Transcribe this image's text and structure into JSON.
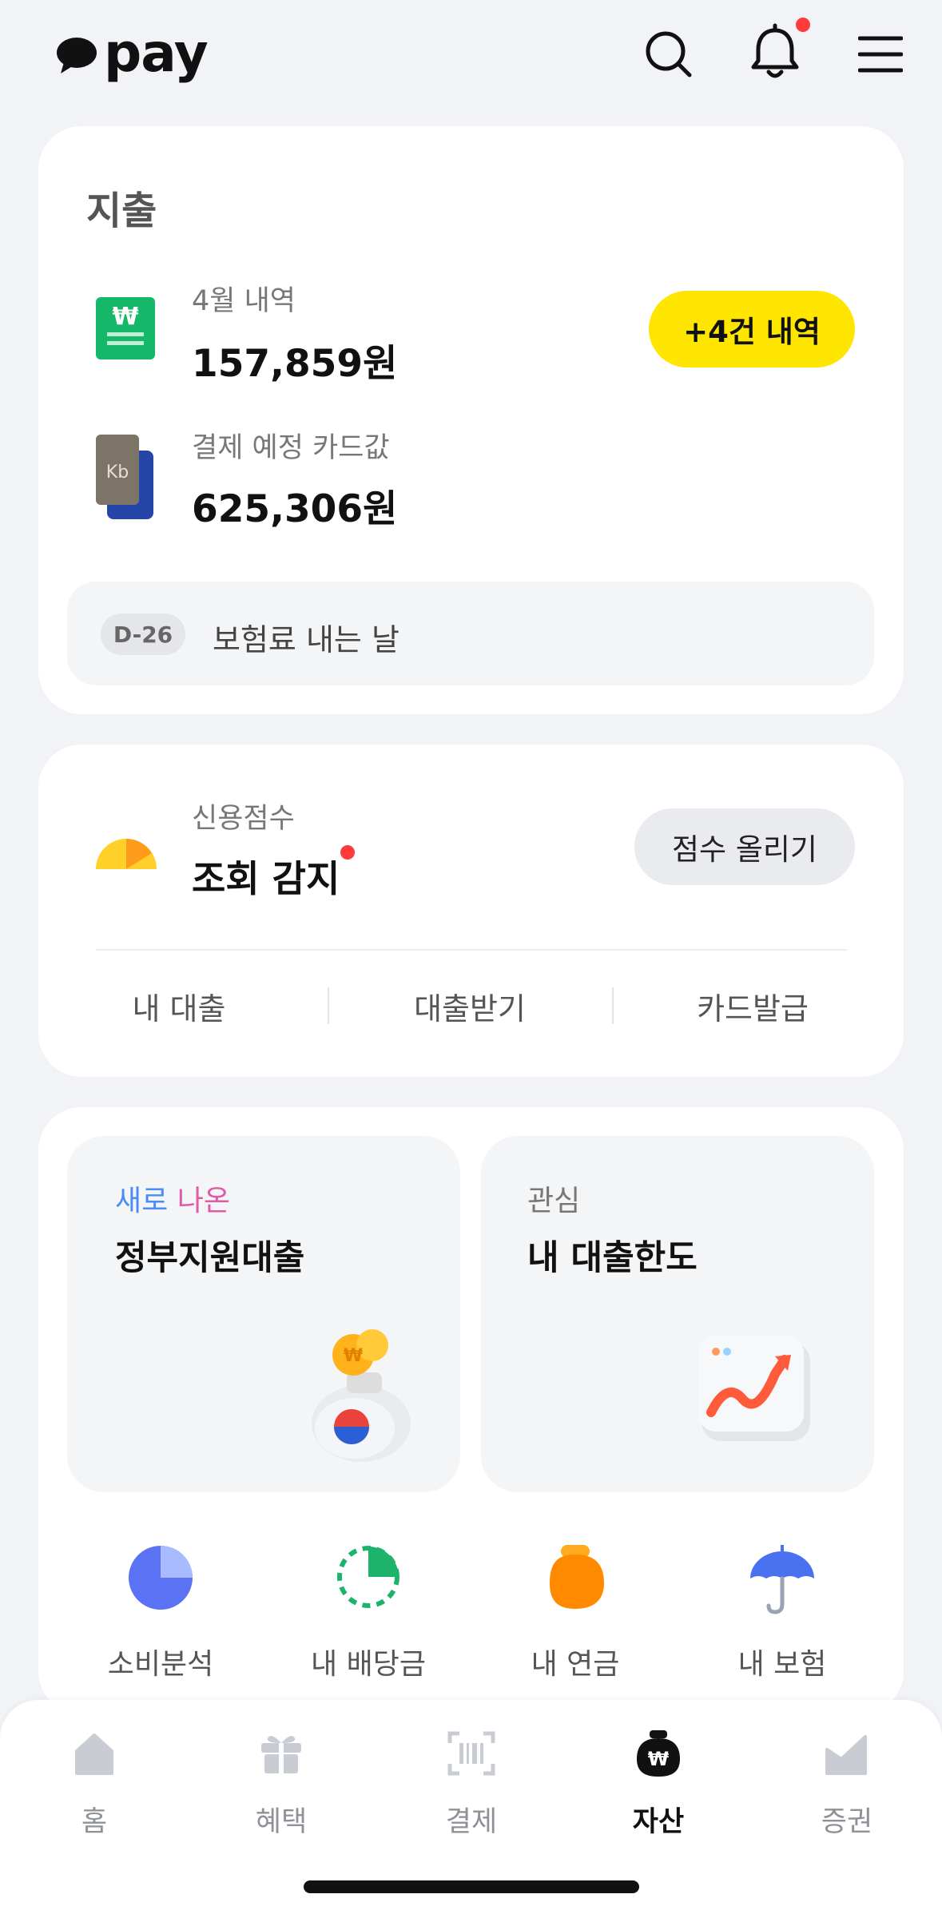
{
  "header": {
    "logo_text": "pay",
    "icons": [
      "search-icon",
      "bell-icon",
      "menu-icon"
    ],
    "notification_dot_color": "#ff3b3b"
  },
  "expenses": {
    "title": "지출",
    "monthly_label": "4월 내역",
    "monthly_amount": "157,859원",
    "history_button": "+4건 내역",
    "card_due_label": "결제 예정 카드값",
    "card_due_amount": "625,306원",
    "reminder_badge": "D-26",
    "reminder_text": "보험료 내는 날"
  },
  "credit": {
    "label": "신용점수",
    "status": "조회 감지",
    "raise_button": "점수 올리기",
    "links": [
      "내 대출",
      "대출받기",
      "카드발급"
    ]
  },
  "loans": {
    "tile1": {
      "tag_part1": "새로",
      "tag_part2": "나온",
      "title": "정부지원대출"
    },
    "tile2": {
      "tag": "관심",
      "title": "내 대출한도"
    }
  },
  "quick_menu": [
    {
      "label": "소비분석",
      "icon": "pie-chart-icon"
    },
    {
      "label": "내 배당금",
      "icon": "dividend-icon"
    },
    {
      "label": "내 연금",
      "icon": "pension-pouch-icon"
    },
    {
      "label": "내 보험",
      "icon": "umbrella-icon"
    }
  ],
  "bottom_nav": [
    {
      "label": "홈",
      "icon": "home-icon",
      "active": false
    },
    {
      "label": "혜택",
      "icon": "gift-icon",
      "active": false
    },
    {
      "label": "결제",
      "icon": "barcode-icon",
      "active": false
    },
    {
      "label": "자산",
      "icon": "money-bag-icon",
      "active": true
    },
    {
      "label": "증권",
      "icon": "stocks-icon",
      "active": false
    }
  ],
  "colors": {
    "accent_yellow": "#ffe600",
    "brand_green": "#15b868",
    "tag_blue": "#4a8bf5",
    "tag_pink": "#e05aa8"
  }
}
